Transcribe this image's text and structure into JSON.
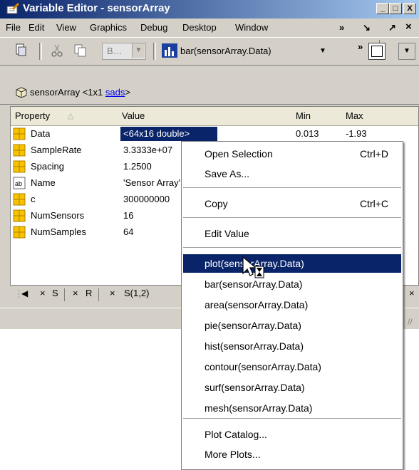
{
  "window": {
    "title": "Variable Editor - sensorArray",
    "min": "_",
    "max": "□",
    "close": "X"
  },
  "menubar": [
    "File",
    "Edit",
    "View",
    "Graphics",
    "Debug",
    "Desktop",
    "Window"
  ],
  "menubar_right": {
    "more": "»",
    "undock": "↘",
    "dock": "↗",
    "close": "×"
  },
  "toolbar": {
    "combo_value": "B…",
    "plot_label": "bar(sensorArray.Data)",
    "more": "»"
  },
  "breadcrumb": {
    "name": "sensorArray",
    "size_prefix": "<1x1 ",
    "class_link": "sads",
    "size_suffix": ">"
  },
  "grid": {
    "headers": {
      "property": "Property",
      "sort": "△",
      "value": "Value",
      "min": "Min",
      "max": "Max"
    },
    "rows": [
      {
        "icon": "grid",
        "name": "Data",
        "value": "<64x16 double>",
        "min": "0.013",
        "max": "-1.93"
      },
      {
        "icon": "grid",
        "name": "SampleRate",
        "value": "3.3333e+07",
        "min": "",
        "max": ""
      },
      {
        "icon": "grid",
        "name": "Spacing",
        "value": "1.2500",
        "min": "",
        "max": ""
      },
      {
        "icon": "ab",
        "name": "Name",
        "value": "'Sensor Array'",
        "min": "",
        "max": ""
      },
      {
        "icon": "grid",
        "name": "c",
        "value": "300000000",
        "min": "",
        "max": ""
      },
      {
        "icon": "grid",
        "name": "NumSensors",
        "value": "16",
        "min": "",
        "max": ""
      },
      {
        "icon": "grid",
        "name": "NumSamples",
        "value": "64",
        "min": "",
        "max": ""
      }
    ]
  },
  "tabs": {
    "items": [
      "S",
      "R",
      "S(1,2)"
    ],
    "close": "×"
  },
  "context_menu": {
    "open_selection": "Open Selection",
    "open_selection_shortcut": "Ctrl+D",
    "save_as": "Save As...",
    "copy": "Copy",
    "copy_shortcut": "Ctrl+C",
    "edit_value": "Edit Value",
    "plots": [
      "plot(sensorArray.Data)",
      "bar(sensorArray.Data)",
      "area(sensorArray.Data)",
      "pie(sensorArray.Data)",
      "hist(sensorArray.Data)",
      "contour(sensorArray.Data)",
      "surf(sensorArray.Data)",
      "mesh(sensorArray.Data)"
    ],
    "plot_catalog": "Plot Catalog...",
    "more_plots": "More Plots..."
  },
  "colors": {
    "titlebar_start": "#0a246a",
    "titlebar_end": "#a6caf0",
    "selection": "#0a246a",
    "link": "#0000ee"
  }
}
